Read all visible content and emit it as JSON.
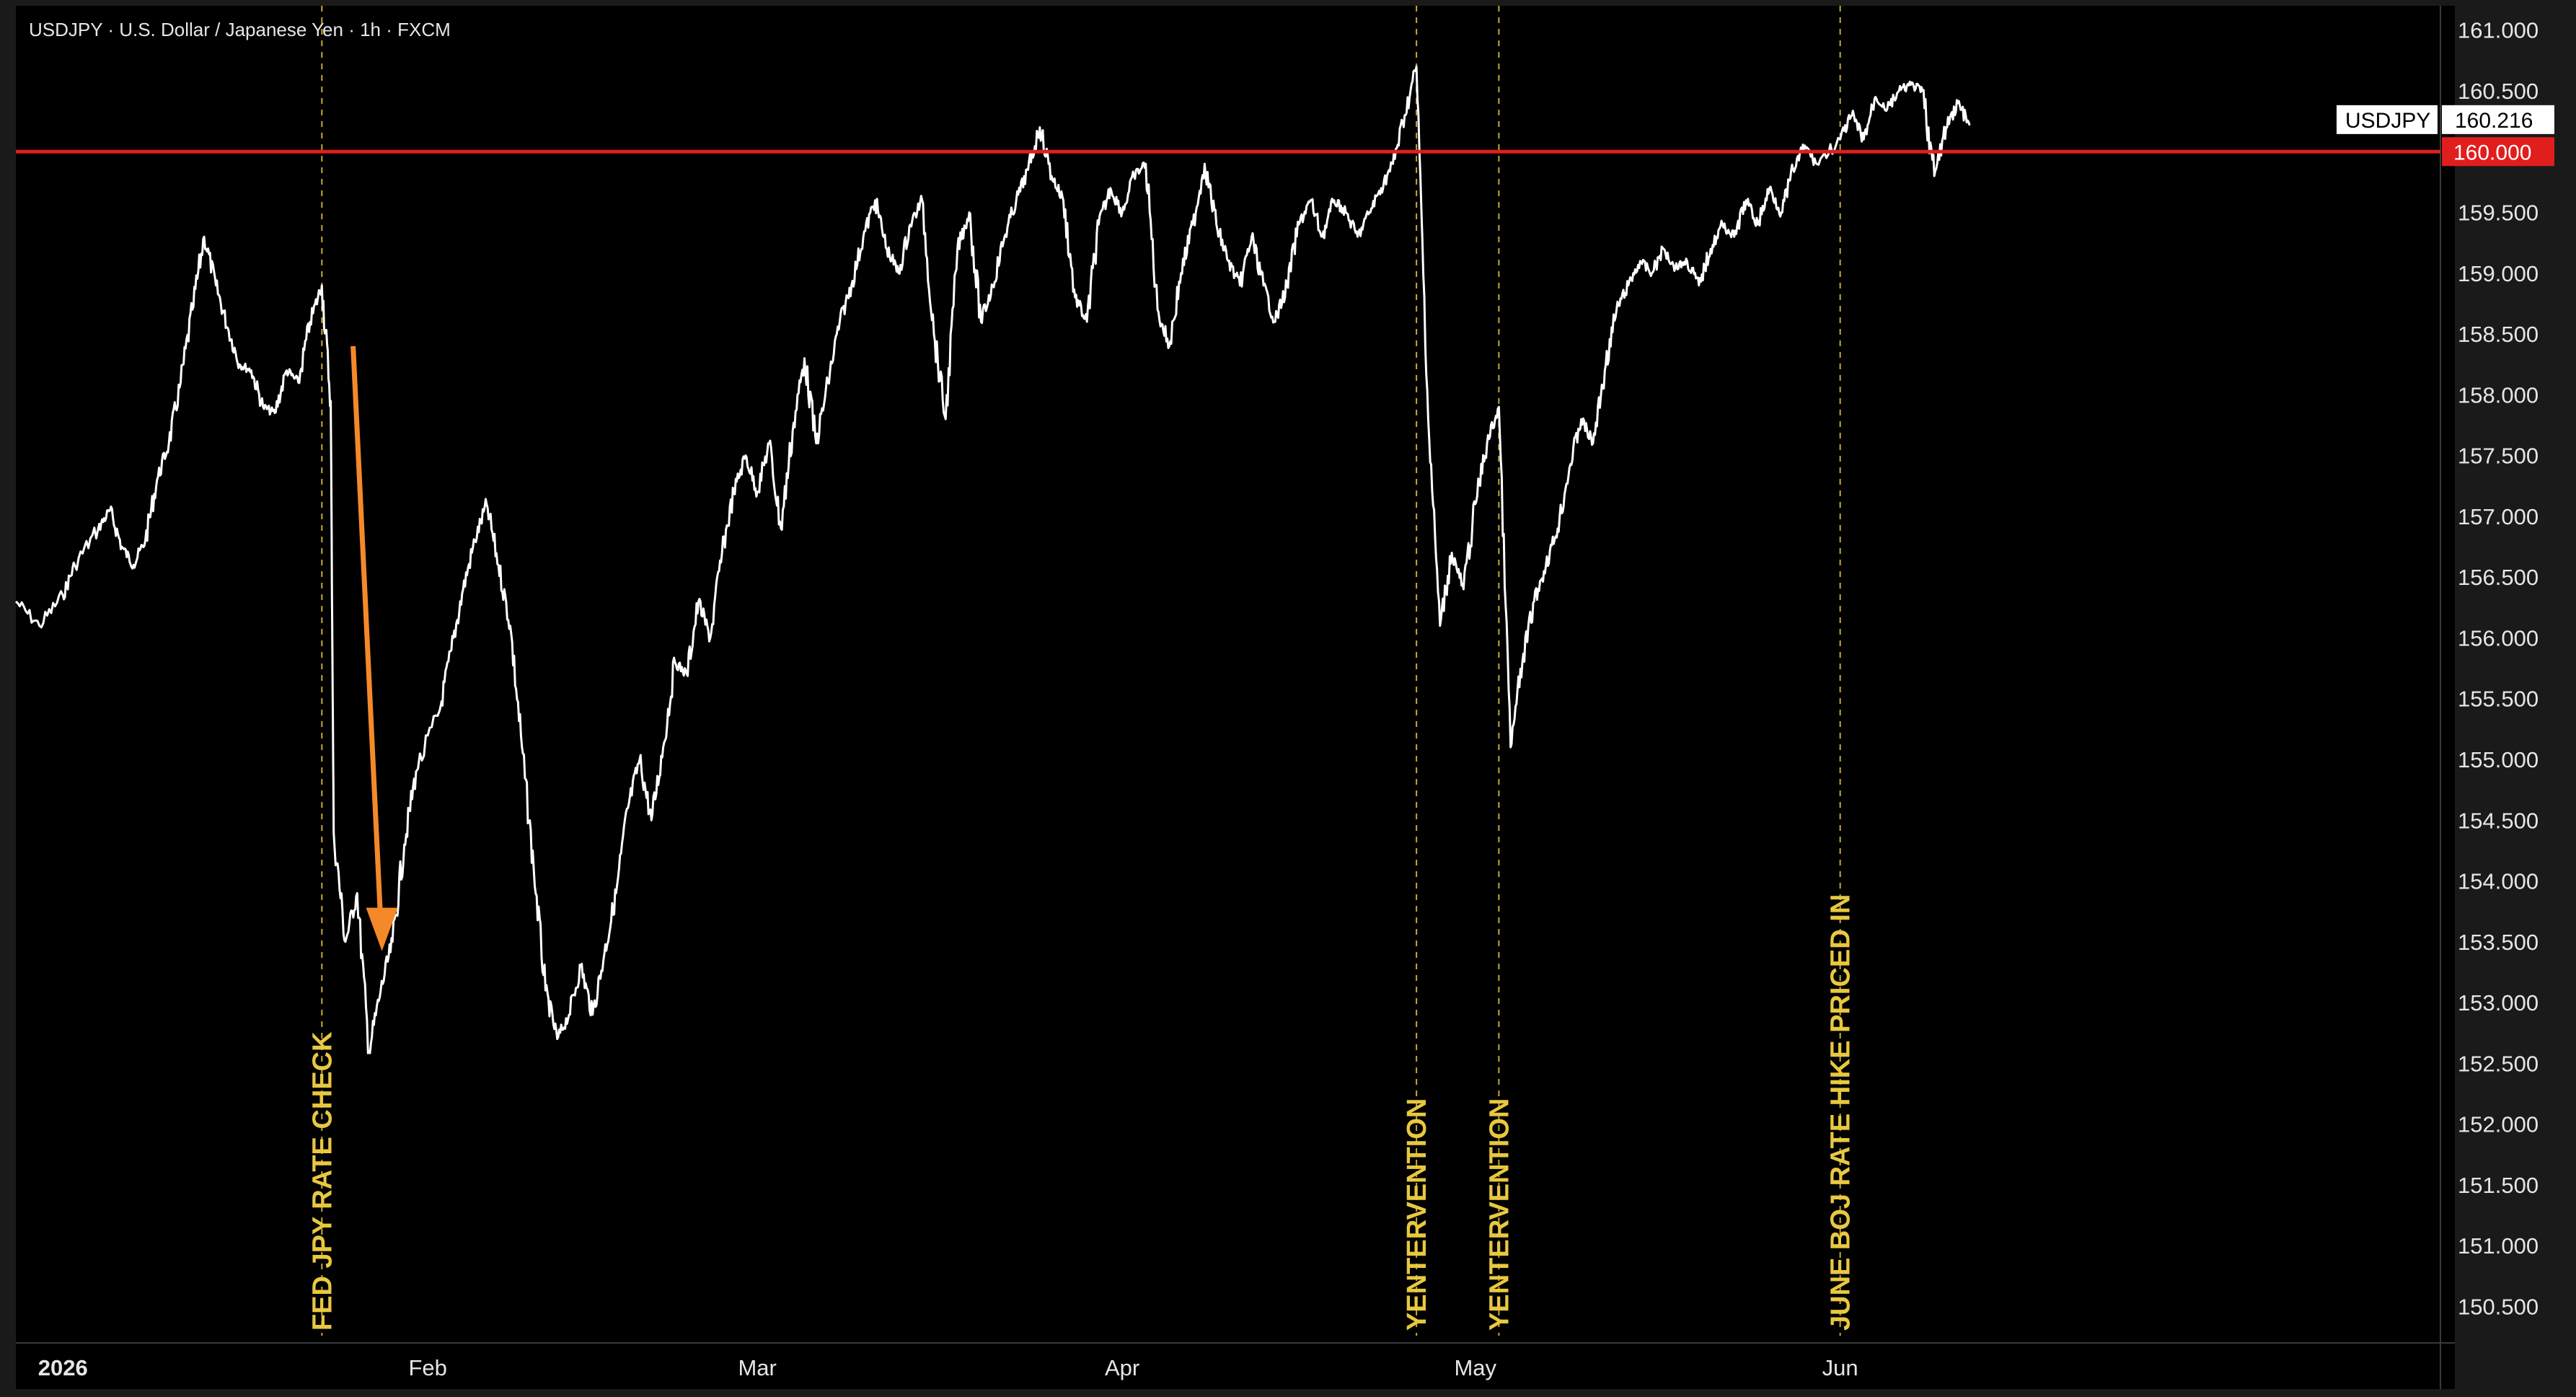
{
  "header": {
    "title": "USDJPY · U.S. Dollar / Japanese Yen · 1h · FXCM"
  },
  "colors": {
    "background": "#000000",
    "frame": "#1a1a1a",
    "price_line": "#ffffff",
    "level_line": "#e01e1e",
    "annotation": "#e8c840",
    "arrow": "#f5892a",
    "axis_text": "#e6e6e6"
  },
  "chart_data": {
    "type": "line",
    "title": "USDJPY · U.S. Dollar / Japanese Yen · 1h · FXCM",
    "xlabel": "",
    "ylabel": "",
    "x_tick_labels": [
      "2026",
      "Feb",
      "Mar",
      "Apr",
      "May",
      "Jun"
    ],
    "x_ticks": [
      "2026-01-01",
      "2026-02-01",
      "2026-03-01",
      "2026-04-01",
      "2026-05-01",
      "2026-06-01"
    ],
    "xlim": [
      "2025-12-28",
      "2026-07-22"
    ],
    "y_ticks": [
      150.5,
      151,
      151.5,
      152,
      152.5,
      153,
      153.5,
      154,
      154.5,
      155,
      155.5,
      156,
      156.5,
      157,
      157.5,
      158,
      158.5,
      159,
      159.5,
      160,
      160.5,
      161
    ],
    "y_tick_labels": [
      "150.500",
      "151.000",
      "151.500",
      "152.000",
      "152.500",
      "153.000",
      "153.500",
      "154.000",
      "154.500",
      "155.000",
      "155.500",
      "156.000",
      "156.500",
      "157.000",
      "157.500",
      "158.000",
      "158.500",
      "159.000",
      "159.500",
      "160.000",
      "160.500",
      "161.000"
    ],
    "ylim": [
      150.2,
      161.2
    ],
    "grid": false,
    "series": [
      {
        "name": "USDJPY",
        "points": [
          [
            "2025-12-28",
            156.3
          ],
          [
            "2025-12-30",
            156.1
          ],
          [
            "2026-01-01",
            156.35
          ],
          [
            "2026-01-02",
            156.6
          ],
          [
            "2026-01-04",
            156.9
          ],
          [
            "2026-01-05",
            157.05
          ],
          [
            "2026-01-06",
            156.75
          ],
          [
            "2026-01-07",
            156.6
          ],
          [
            "2026-01-08",
            156.8
          ],
          [
            "2026-01-09",
            157.3
          ],
          [
            "2026-01-10",
            157.6
          ],
          [
            "2026-01-11",
            158.1
          ],
          [
            "2026-01-12",
            158.7
          ],
          [
            "2026-01-13",
            159.3
          ],
          [
            "2026-01-14",
            158.9
          ],
          [
            "2026-01-15",
            158.55
          ],
          [
            "2026-01-16",
            158.25
          ],
          [
            "2026-01-17",
            158.2
          ],
          [
            "2026-01-18",
            157.9
          ],
          [
            "2026-01-19",
            157.85
          ],
          [
            "2026-01-20",
            158.2
          ],
          [
            "2026-01-21",
            158.1
          ],
          [
            "2026-01-22",
            158.6
          ],
          [
            "2026-01-23",
            158.9
          ],
          [
            "2026-01-23T18:00",
            157.95
          ],
          [
            "2026-01-24",
            154.4
          ],
          [
            "2026-01-25",
            153.5
          ],
          [
            "2026-01-26",
            153.9
          ],
          [
            "2026-01-27",
            152.6
          ],
          [
            "2026-01-28",
            153.1
          ],
          [
            "2026-01-29",
            153.5
          ],
          [
            "2026-01-30",
            154.3
          ],
          [
            "2026-01-31",
            154.9
          ],
          [
            "2026-02-02",
            155.4
          ],
          [
            "2026-02-03",
            155.9
          ],
          [
            "2026-02-04",
            156.4
          ],
          [
            "2026-02-05",
            156.8
          ],
          [
            "2026-02-06",
            157.1
          ],
          [
            "2026-02-07",
            156.6
          ],
          [
            "2026-02-08",
            156.1
          ],
          [
            "2026-02-09",
            155.1
          ],
          [
            "2026-02-10",
            154.1
          ],
          [
            "2026-02-11",
            153.1
          ],
          [
            "2026-02-12",
            152.7
          ],
          [
            "2026-02-13",
            152.9
          ],
          [
            "2026-02-14",
            153.3
          ],
          [
            "2026-02-15",
            152.9
          ],
          [
            "2026-02-16",
            153.4
          ],
          [
            "2026-02-17",
            153.9
          ],
          [
            "2026-02-18",
            154.6
          ],
          [
            "2026-02-19",
            155.0
          ],
          [
            "2026-02-20",
            154.5
          ],
          [
            "2026-02-21",
            155.1
          ],
          [
            "2026-02-22",
            155.8
          ],
          [
            "2026-02-23",
            155.7
          ],
          [
            "2026-02-24",
            156.3
          ],
          [
            "2026-02-25",
            156.0
          ],
          [
            "2026-02-26",
            156.7
          ],
          [
            "2026-02-27",
            157.2
          ],
          [
            "2026-02-28",
            157.5
          ],
          [
            "2026-03-01",
            157.2
          ],
          [
            "2026-03-02",
            157.6
          ],
          [
            "2026-03-03",
            156.9
          ],
          [
            "2026-03-04",
            157.7
          ],
          [
            "2026-03-05",
            158.3
          ],
          [
            "2026-03-06",
            157.6
          ],
          [
            "2026-03-07",
            158.1
          ],
          [
            "2026-03-08",
            158.6
          ],
          [
            "2026-03-09",
            158.9
          ],
          [
            "2026-03-10",
            159.3
          ],
          [
            "2026-03-11",
            159.6
          ],
          [
            "2026-03-12",
            159.2
          ],
          [
            "2026-03-13",
            159.0
          ],
          [
            "2026-03-14",
            159.4
          ],
          [
            "2026-03-15",
            159.6
          ],
          [
            "2026-03-16",
            158.5
          ],
          [
            "2026-03-17",
            157.8
          ],
          [
            "2026-03-18",
            159.2
          ],
          [
            "2026-03-19",
            159.5
          ],
          [
            "2026-03-20",
            158.6
          ],
          [
            "2026-03-21",
            158.9
          ],
          [
            "2026-03-22",
            159.3
          ],
          [
            "2026-03-23",
            159.6
          ],
          [
            "2026-03-24",
            159.85
          ],
          [
            "2026-03-25",
            160.2
          ],
          [
            "2026-03-26",
            159.8
          ],
          [
            "2026-03-27",
            159.6
          ],
          [
            "2026-03-28",
            158.8
          ],
          [
            "2026-03-29",
            158.6
          ],
          [
            "2026-03-30",
            159.4
          ],
          [
            "2026-03-31",
            159.7
          ],
          [
            "2026-04-01",
            159.5
          ],
          [
            "2026-04-02",
            159.8
          ],
          [
            "2026-04-03",
            159.9
          ],
          [
            "2026-04-04",
            158.7
          ],
          [
            "2026-04-05",
            158.4
          ],
          [
            "2026-04-06",
            159.0
          ],
          [
            "2026-04-07",
            159.4
          ],
          [
            "2026-04-08",
            159.9
          ],
          [
            "2026-04-09",
            159.4
          ],
          [
            "2026-04-10",
            159.1
          ],
          [
            "2026-04-11",
            158.9
          ],
          [
            "2026-04-12",
            159.3
          ],
          [
            "2026-04-13",
            158.9
          ],
          [
            "2026-04-14",
            158.6
          ],
          [
            "2026-04-15",
            158.9
          ],
          [
            "2026-04-16",
            159.4
          ],
          [
            "2026-04-17",
            159.6
          ],
          [
            "2026-04-18",
            159.3
          ],
          [
            "2026-04-19",
            159.6
          ],
          [
            "2026-04-20",
            159.5
          ],
          [
            "2026-04-21",
            159.3
          ],
          [
            "2026-04-22",
            159.5
          ],
          [
            "2026-04-23",
            159.7
          ],
          [
            "2026-04-24",
            159.9
          ],
          [
            "2026-04-25",
            160.3
          ],
          [
            "2026-04-26",
            160.7
          ],
          [
            "2026-04-27",
            157.8
          ],
          [
            "2026-04-28",
            156.1
          ],
          [
            "2026-04-29",
            156.7
          ],
          [
            "2026-04-30",
            156.4
          ],
          [
            "2026-05-01",
            157.1
          ],
          [
            "2026-05-02",
            157.6
          ],
          [
            "2026-05-03",
            157.9
          ],
          [
            "2026-05-04",
            155.1
          ],
          [
            "2026-05-05",
            155.8
          ],
          [
            "2026-05-06",
            156.3
          ],
          [
            "2026-05-07",
            156.6
          ],
          [
            "2026-05-08",
            156.9
          ],
          [
            "2026-05-09",
            157.4
          ],
          [
            "2026-05-10",
            157.8
          ],
          [
            "2026-05-11",
            157.6
          ],
          [
            "2026-05-12",
            158.2
          ],
          [
            "2026-05-13",
            158.7
          ],
          [
            "2026-05-14",
            158.9
          ],
          [
            "2026-05-15",
            159.1
          ],
          [
            "2026-05-16",
            159.0
          ],
          [
            "2026-05-17",
            159.2
          ],
          [
            "2026-05-18",
            159.05
          ],
          [
            "2026-05-19",
            159.1
          ],
          [
            "2026-05-20",
            158.9
          ],
          [
            "2026-05-21",
            159.2
          ],
          [
            "2026-05-22",
            159.4
          ],
          [
            "2026-05-23",
            159.3
          ],
          [
            "2026-05-24",
            159.6
          ],
          [
            "2026-05-25",
            159.4
          ],
          [
            "2026-05-26",
            159.7
          ],
          [
            "2026-05-27",
            159.5
          ],
          [
            "2026-05-28",
            159.85
          ],
          [
            "2026-05-29",
            160.05
          ],
          [
            "2026-05-30",
            159.9
          ],
          [
            "2026-06-01",
            160.1
          ],
          [
            "2026-06-02",
            160.3
          ],
          [
            "2026-06-03",
            160.1
          ],
          [
            "2026-06-04",
            160.45
          ],
          [
            "2026-06-05",
            160.35
          ],
          [
            "2026-06-06",
            160.5
          ],
          [
            "2026-06-07",
            160.55
          ],
          [
            "2026-06-08",
            160.5
          ],
          [
            "2026-06-09",
            159.8
          ],
          [
            "2026-06-10",
            160.2
          ],
          [
            "2026-06-11",
            160.4
          ],
          [
            "2026-06-12",
            160.216
          ]
        ]
      }
    ],
    "horizontal_line": {
      "value": 160.0,
      "label": "160.000"
    },
    "last_price": {
      "symbol": "USDJPY",
      "value": 160.216,
      "label": "160.216"
    },
    "annotations": [
      {
        "date": "2026-01-23",
        "label": "FED JPY RATE CHECK"
      },
      {
        "date": "2026-04-26",
        "label": "YENTERVENTION"
      },
      {
        "date": "2026-05-03",
        "label": "YENTERVENTION"
      },
      {
        "date": "2026-06-01",
        "label": "JUNE BOJ RATE HIKE PRICED IN"
      }
    ],
    "arrow": {
      "from": [
        "2026-01-27",
        158.4
      ],
      "to": [
        "2026-01-27",
        153.4
      ]
    }
  }
}
